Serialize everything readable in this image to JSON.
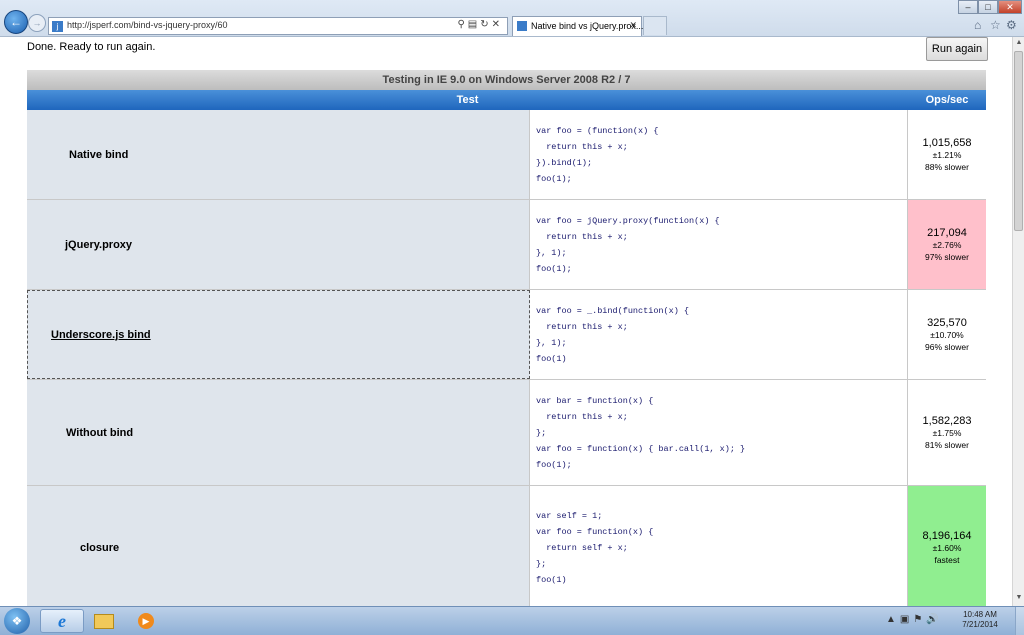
{
  "browser": {
    "url": "http://jsperf.com/bind-vs-jquery-proxy/60",
    "tab_title": "Native bind vs jQuery.prox..."
  },
  "page": {
    "status": "Done. Ready to run again.",
    "run_again_label": "Run again",
    "caption": "Testing in IE 9.0 on Windows Server 2008 R2 / 7",
    "col_test": "Test",
    "col_ops": "Ops/sec",
    "rows": [
      {
        "title": "Native bind",
        "code": [
          "var foo = (function(x) {",
          "  return this + x;",
          "}).bind(1);",
          "foo(1);"
        ],
        "ops": "1,015,658",
        "error": "±1.21%",
        "relative": "88% slower",
        "bg": "#ffffff"
      },
      {
        "title": "jQuery.proxy",
        "code": [
          "var foo = jQuery.proxy(function(x) {",
          "  return this + x;",
          "}, 1);",
          "foo(1);"
        ],
        "ops": "217,094",
        "error": "±2.76%",
        "relative": "97% slower",
        "bg": "#ffc0cb"
      },
      {
        "title": "Underscore.js bind",
        "code": [
          "var foo = _.bind(function(x) {",
          "  return this + x;",
          "}, 1);",
          "foo(1)"
        ],
        "ops": "325,570",
        "error": "±10.70%",
        "relative": "96% slower",
        "bg": "#ffffff"
      },
      {
        "title": "Without bind",
        "code": [
          "var bar = function(x) {",
          "  return this + x;",
          "};",
          "var foo = function(x) { bar.call(1, x); }",
          "foo(1);"
        ],
        "ops": "1,582,283",
        "error": "±1.75%",
        "relative": "81% slower",
        "bg": "#ffffff"
      },
      {
        "title": "closure",
        "code": [
          "var self = 1;",
          "",
          "var foo = function(x) {",
          "  return self + x;",
          "};",
          "foo(1)"
        ],
        "ops": "8,196,164",
        "error": "±1.60%",
        "relative": "fastest",
        "bg": "#90ee90"
      }
    ]
  },
  "taskbar": {
    "time": "10:48 AM",
    "date": "7/21/2014"
  },
  "icons": [
    "back-icon",
    "forward-icon",
    "search-icon",
    "refresh-icon",
    "close-icon",
    "home-icon",
    "star-icon",
    "gear-icon",
    "windows-logo-icon",
    "ie-icon",
    "folder-icon",
    "media-player-icon"
  ]
}
